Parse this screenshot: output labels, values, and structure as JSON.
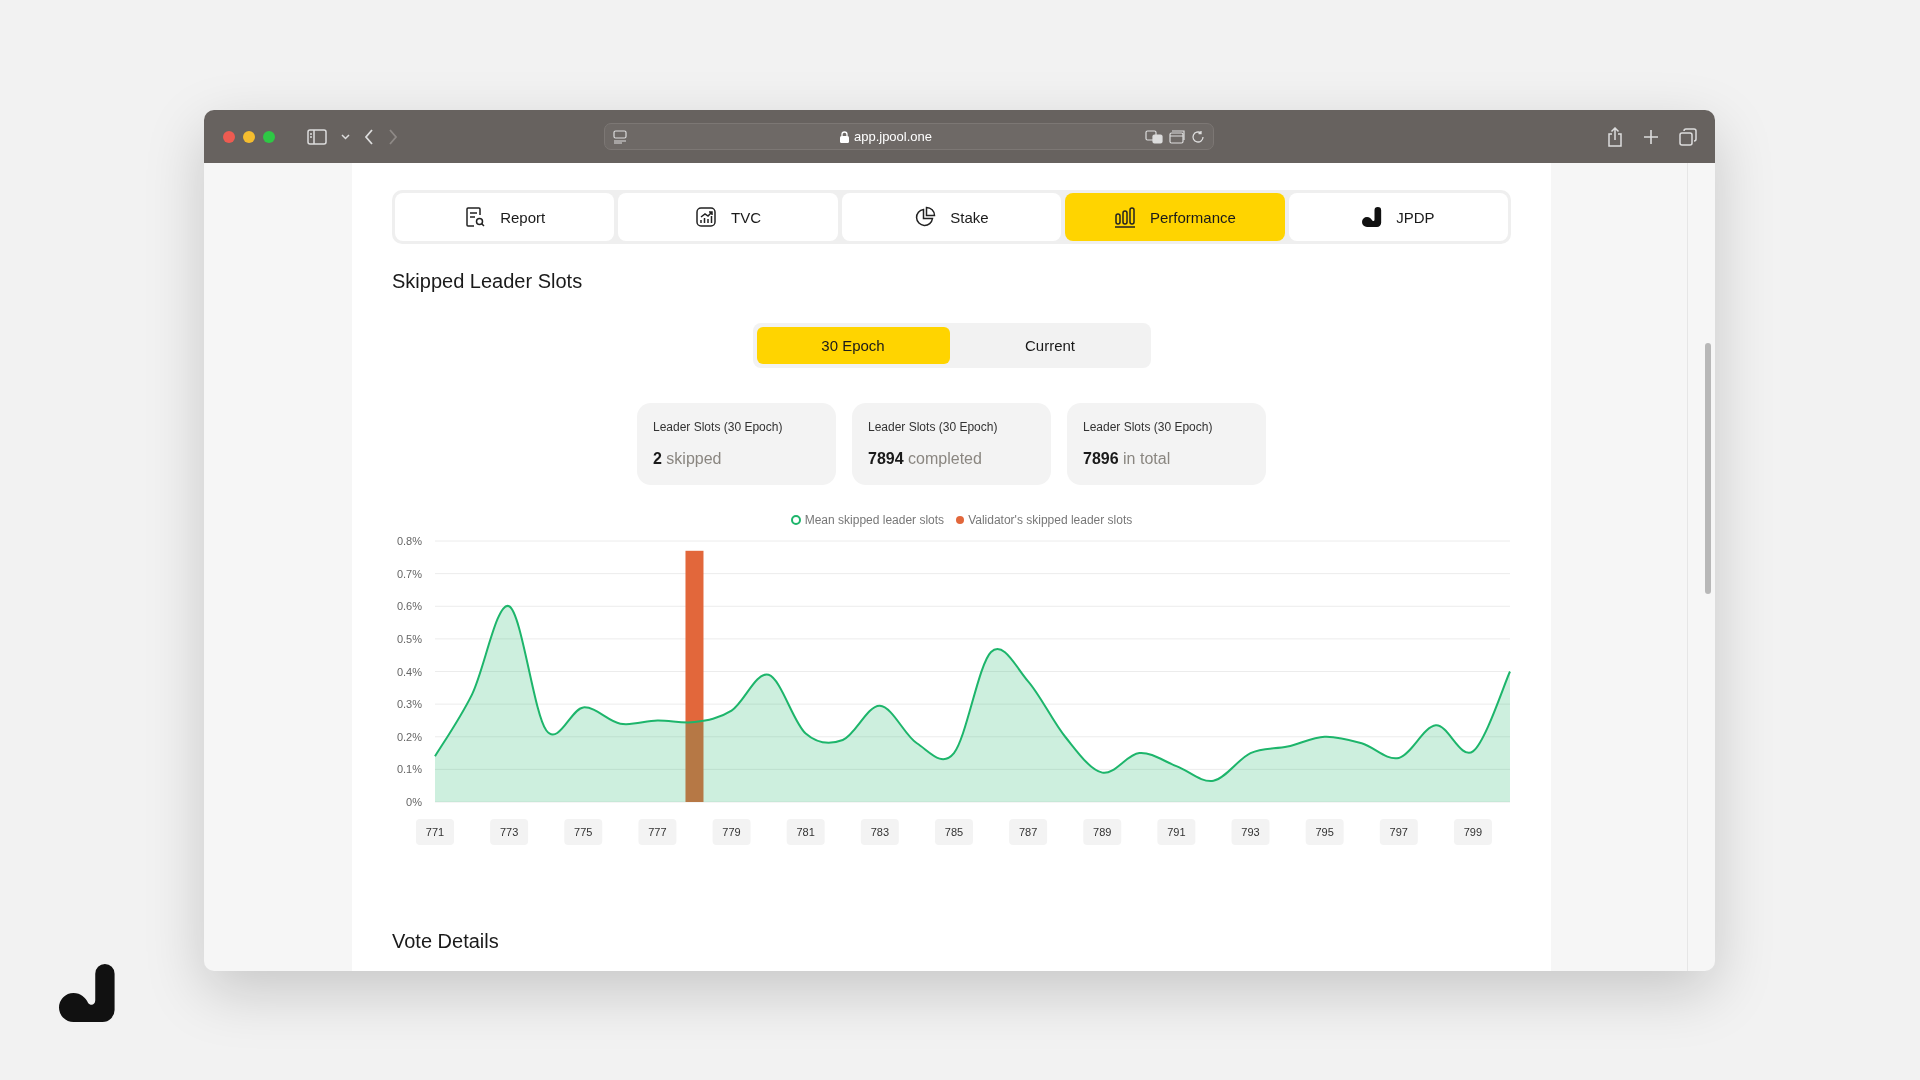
{
  "browser": {
    "url": "app.jpool.one"
  },
  "tabs": [
    {
      "label": "Report",
      "kind": "report",
      "selected": false
    },
    {
      "label": "TVC",
      "kind": "trend",
      "selected": false
    },
    {
      "label": "Stake",
      "kind": "pie",
      "selected": false
    },
    {
      "label": "Performance",
      "kind": "bars",
      "selected": true
    },
    {
      "label": "JPDP",
      "kind": "logo",
      "selected": false
    }
  ],
  "section": {
    "title": "Skipped Leader Slots"
  },
  "period_toggle": [
    {
      "label": "30 Epoch",
      "selected": true
    },
    {
      "label": "Current",
      "selected": false
    }
  ],
  "cards": [
    {
      "label": "Leader Slots (30 Epoch)",
      "value": "2",
      "unit": "skipped"
    },
    {
      "label": "Leader Slots (30 Epoch)",
      "value": "7894",
      "unit": "completed"
    },
    {
      "label": "Leader Slots (30 Epoch)",
      "value": "7896",
      "unit": "in total"
    }
  ],
  "chart_data": {
    "type": "area",
    "grid": true,
    "legend": true,
    "xlim": [
      771,
      800
    ],
    "x": [
      771,
      772,
      773,
      774,
      775,
      776,
      777,
      778,
      779,
      780,
      781,
      782,
      783,
      784,
      785,
      786,
      787,
      788,
      789,
      790,
      791,
      792,
      793,
      794,
      795,
      796,
      797,
      798,
      799,
      800
    ],
    "xticks": [
      771,
      773,
      775,
      777,
      779,
      781,
      783,
      785,
      787,
      789,
      791,
      793,
      795,
      797,
      799
    ],
    "ylim": [
      0,
      0.8
    ],
    "yticks": [
      {
        "value": 0,
        "label": "0%"
      },
      {
        "value": 0.1,
        "label": "0.1%"
      },
      {
        "value": 0.2,
        "label": "0.2%"
      },
      {
        "value": 0.3,
        "label": "0.3%"
      },
      {
        "value": 0.4,
        "label": "0.4%"
      },
      {
        "value": 0.5,
        "label": "0.5%"
      },
      {
        "value": 0.6,
        "label": "0.6%"
      },
      {
        "value": 0.7,
        "label": "0.7%"
      },
      {
        "value": 0.8,
        "label": "0.8%"
      }
    ],
    "series": [
      {
        "name": "Mean skipped leader slots",
        "color": "#1db56b",
        "values": [
          0.14,
          0.33,
          0.6,
          0.22,
          0.29,
          0.24,
          0.25,
          0.245,
          0.28,
          0.39,
          0.21,
          0.19,
          0.295,
          0.18,
          0.15,
          0.46,
          0.37,
          0.2,
          0.09,
          0.15,
          0.11,
          0.065,
          0.15,
          0.17,
          0.2,
          0.18,
          0.135,
          0.235,
          0.155,
          0.4
        ]
      },
      {
        "name": "Validator's skipped leader slots",
        "type": "bar",
        "color": "#e2673b",
        "values": [
          null,
          null,
          null,
          null,
          null,
          null,
          null,
          0.77,
          null,
          null,
          null,
          null,
          null,
          null,
          null,
          null,
          null,
          null,
          null,
          null,
          null,
          null,
          null,
          null,
          null,
          null,
          null,
          null,
          null,
          null
        ]
      }
    ]
  },
  "next_section": {
    "title": "Vote Details"
  }
}
